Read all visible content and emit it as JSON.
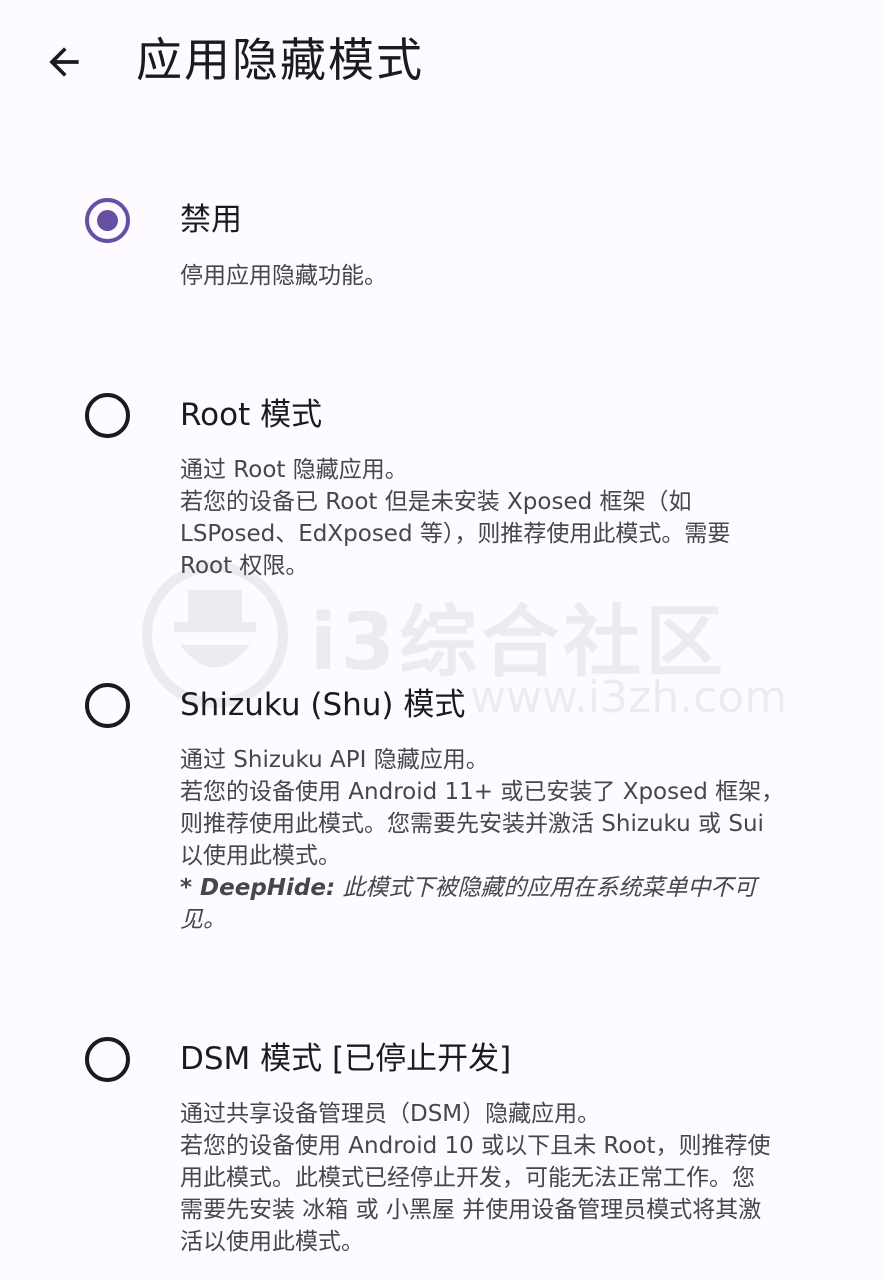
{
  "header": {
    "title": "应用隐藏模式",
    "back_icon": "arrow-left-icon"
  },
  "colors": {
    "accent": "#6750a4",
    "text": "#1b1b1f",
    "secondary_text": "#46464f",
    "background": "#fdfbff"
  },
  "watermark": {
    "text": "i3综合社区",
    "url": "www.i3zh.com"
  },
  "options": [
    {
      "title": "禁用",
      "selected": true,
      "description": [
        "停用应用隐藏功能。"
      ]
    },
    {
      "title": "Root 模式",
      "selected": false,
      "description": [
        "通过 Root 隐藏应用。",
        "若您的设备已 Root 但是未安装 Xposed 框架（如",
        "LSPosed、EdXposed 等），则推荐使用此模式。需要",
        "Root 权限。"
      ]
    },
    {
      "title": "Shizuku (Shu) 模式",
      "selected": false,
      "description": [
        "通过 Shizuku API 隐藏应用。",
        "若您的设备使用 Android 11+ 或已安装了 Xposed 框架，",
        "则推荐使用此模式。您需要先安装并激活 Shizuku 或 Sui",
        "以使用此模式。"
      ],
      "note_label": "* DeepHide:",
      "note_lines": [
        " 此模式下被隐藏的应用在系统菜单中不可",
        "见。"
      ]
    },
    {
      "title": "DSM 模式 [已停止开发]",
      "selected": false,
      "description": [
        "通过共享设备管理员（DSM）隐藏应用。",
        "若您的设备使用 Android 10 或以下且未 Root，则推荐使",
        "用此模式。此模式已经停止开发，可能无法正常工作。您",
        "需要先安装 冰箱 或 小黑屋 并使用设备管理员模式将其激",
        "活以使用此模式。"
      ]
    }
  ]
}
